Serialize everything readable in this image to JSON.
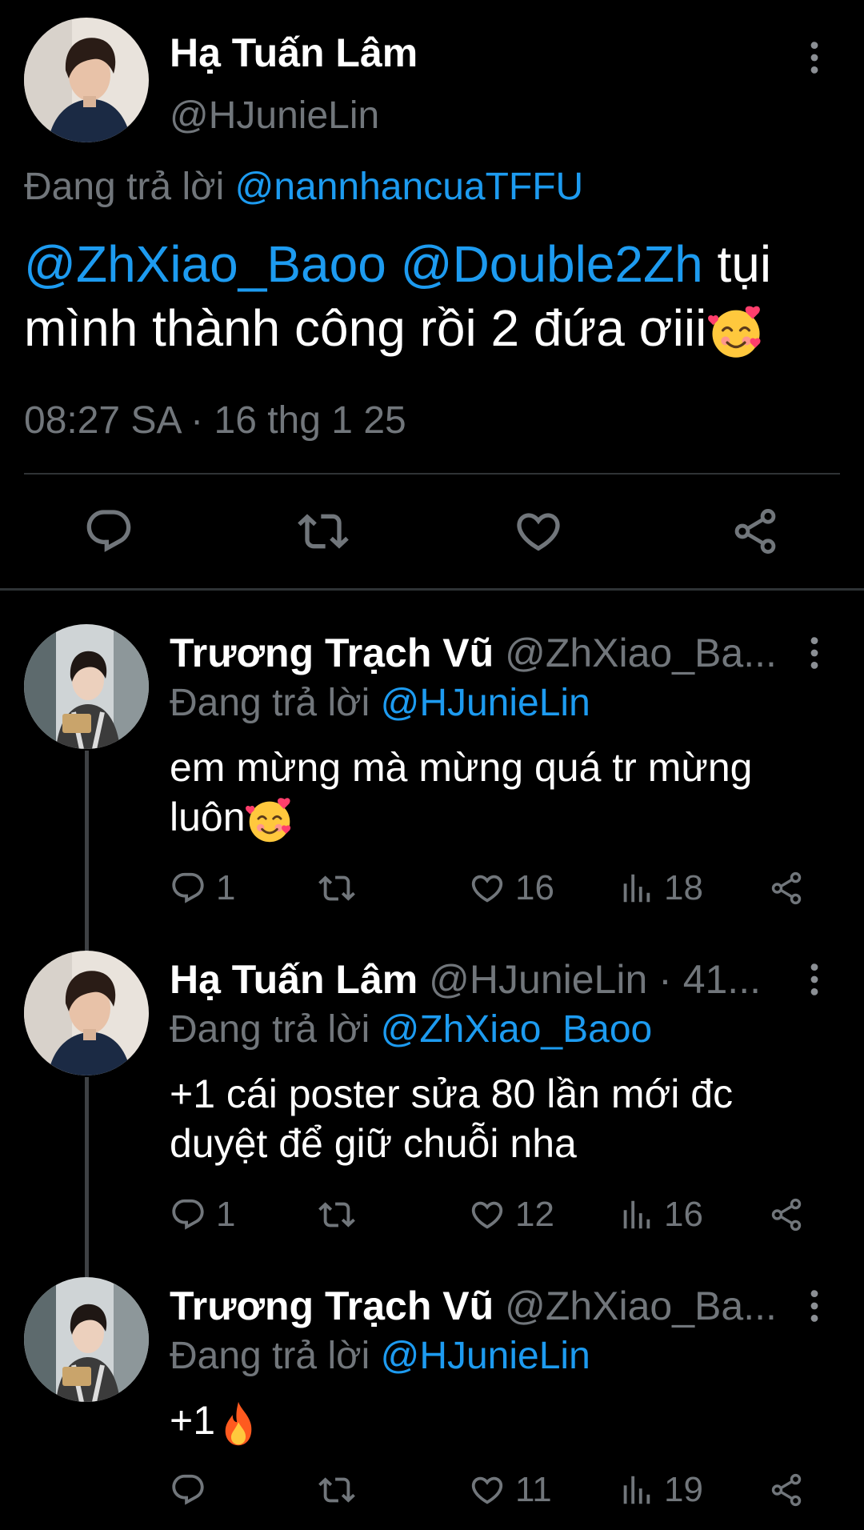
{
  "main_tweet": {
    "author_name": "Hạ Tuấn Lâm",
    "handle": "@HJunieLin",
    "replying_prefix": "Đang trả lời",
    "replying_to": "@nannhancuaTFFU",
    "mentions": [
      "@ZhXiao_Baoo",
      "@Double2Zh"
    ],
    "text_line1_rest": "tụi",
    "text_line2": "mình thành công rồi 2 đứa ơiii",
    "emoji": "smiling-face-with-hearts",
    "timestamp": "08:27 SA · 16 thg 1 25",
    "actions": [
      "reply-icon",
      "retweet-icon",
      "like-icon",
      "share-icon"
    ]
  },
  "replies": [
    {
      "author_name": "Trương Trạch Vũ",
      "handle_meta": "@ZhXiao_Ba...",
      "replying_prefix": "Đang trả lời",
      "replying_to": "@HJunieLin",
      "text_line1": "em mừng mà mừng quá tr mừng",
      "text_line2": "luôn",
      "emoji": "smiling-face-with-hearts",
      "reply_count": "1",
      "like_count": "16",
      "view_count": "18"
    },
    {
      "author_name": "Hạ Tuấn Lâm",
      "handle_meta": "@HJunieLin · 41...",
      "replying_prefix": "Đang trả lời",
      "replying_to": "@ZhXiao_Baoo",
      "text_line1": "+1 cái poster sửa 80 lần mới đc",
      "text_line2": "duyệt để giữ chuỗi nha",
      "reply_count": "1",
      "like_count": "12",
      "view_count": "16"
    },
    {
      "author_name": "Trương Trạch Vũ",
      "handle_meta": "@ZhXiao_Ba...",
      "replying_prefix": "Đang trả lời",
      "replying_to": "@HJunieLin",
      "text_line1": "+1",
      "emoji": "fire",
      "reply_count": "",
      "like_count": "11",
      "view_count": "19"
    }
  ],
  "colors": {
    "background": "#000000",
    "link": "#1d9bf0",
    "secondary": "#71767b",
    "primary": "#e7e9ea"
  }
}
